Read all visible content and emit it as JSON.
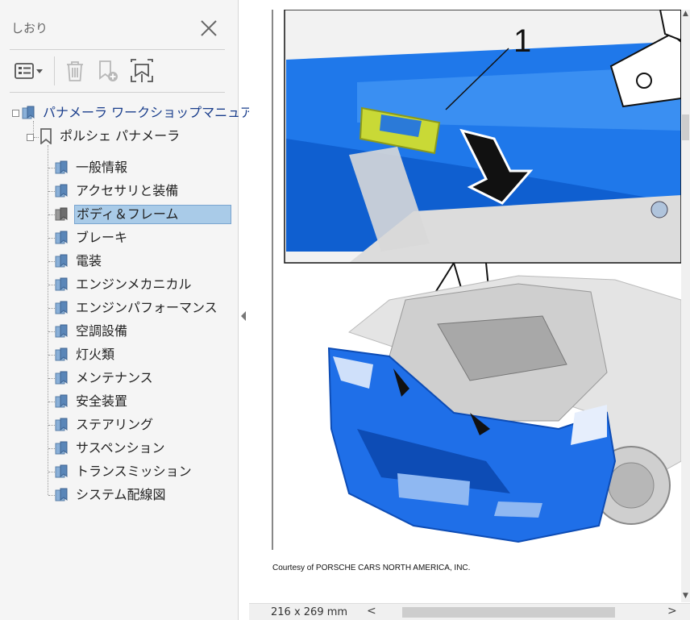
{
  "panel": {
    "title": "しおり",
    "toolbar": {
      "options_icon": "bookmark-options-icon",
      "delete_icon": "trash-icon",
      "new_bookmark_icon": "new-bookmark-icon",
      "expand_icon": "expand-bookmark-icon"
    }
  },
  "tree": {
    "root": "パナメーラ ワークショップマニュアル",
    "child": "ポルシェ パナメーラ",
    "items": [
      "一般情報",
      "アクセサリと装備",
      "ボディ＆フレーム",
      "ブレーキ",
      "電装",
      "エンジンメカニカル",
      "エンジンパフォーマンス",
      "空調設備",
      "灯火類",
      "メンテナンス",
      "安全装置",
      "ステアリング",
      "サスペンション",
      "トランスミッション",
      "システム配線図"
    ],
    "selected_index": 2
  },
  "document": {
    "callout_number": "1",
    "caption": "Courtesy of PORSCHE CARS NORTH AMERICA, INC."
  },
  "status": {
    "page_size": "216 x 269 mm"
  },
  "colors": {
    "selection": "#a9cbe8",
    "root_text": "#1a3e8c",
    "panel_bg": "#f5f5f5",
    "part_blue": "#1f6fe8"
  }
}
